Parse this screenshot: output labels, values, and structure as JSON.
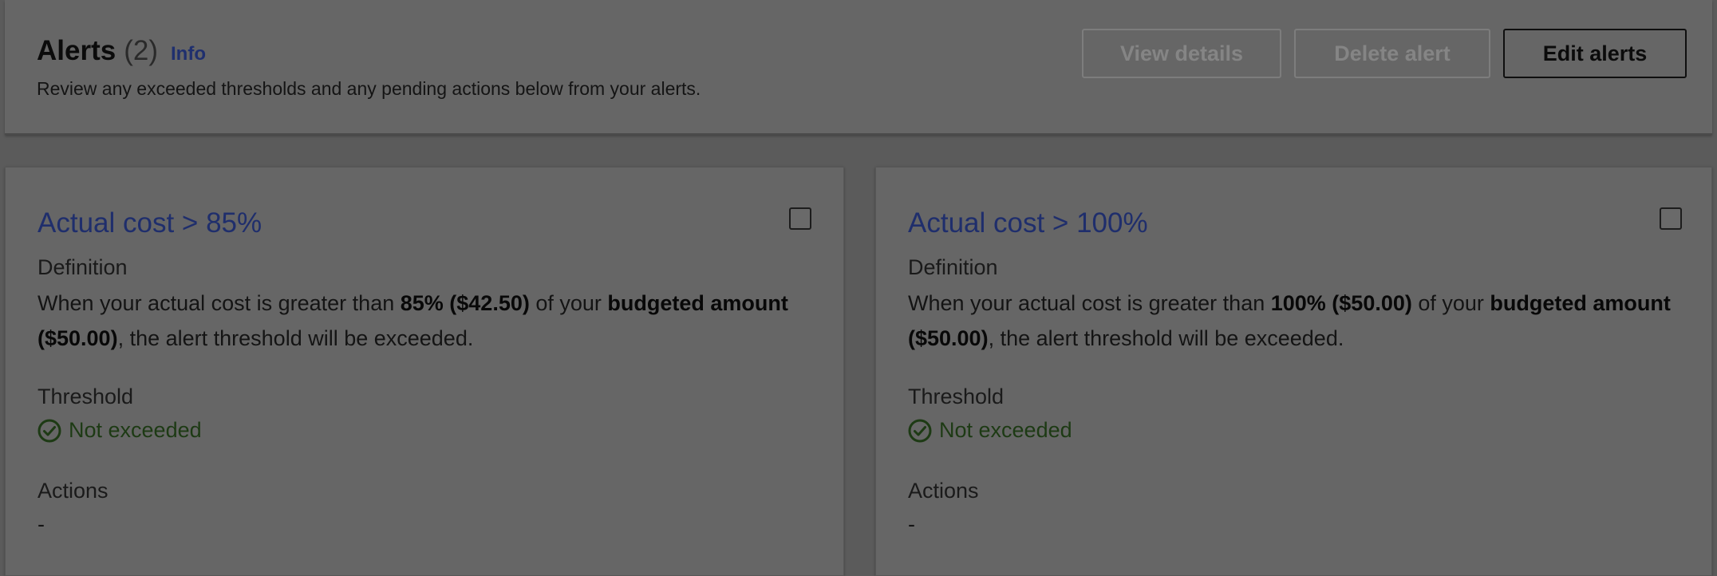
{
  "header": {
    "title": "Alerts",
    "count": "(2)",
    "info_link": "Info",
    "description": "Review any exceeded thresholds and any pending actions below from your alerts.",
    "buttons": {
      "view_details": "View details",
      "delete_alert": "Delete alert",
      "edit_alerts": "Edit alerts"
    }
  },
  "alerts": [
    {
      "title": "Actual cost > 85%",
      "definition_label": "Definition",
      "definition": {
        "part1": "When your actual cost is greater than ",
        "threshold": "85% ($42.50)",
        "part2": " of your ",
        "budget": "budgeted amount ($50.00)",
        "part3": ", the alert threshold will be exceeded."
      },
      "threshold_label": "Threshold",
      "threshold_status": "Not exceeded",
      "actions_label": "Actions",
      "actions_value": "-"
    },
    {
      "title": "Actual cost > 100%",
      "definition_label": "Definition",
      "definition": {
        "part1": "When your actual cost is greater than ",
        "threshold": "100% ($50.00)",
        "part2": " of your ",
        "budget": "budgeted amount ($50.00)",
        "part3": ", the alert threshold will be exceeded."
      },
      "threshold_label": "Threshold",
      "threshold_status": "Not exceeded",
      "actions_label": "Actions",
      "actions_value": "-"
    }
  ],
  "icons": {
    "status": "check-circle-icon"
  },
  "colors": {
    "link": "#1f2e6c",
    "success": "#1d3a14",
    "overlay": "#666666"
  }
}
